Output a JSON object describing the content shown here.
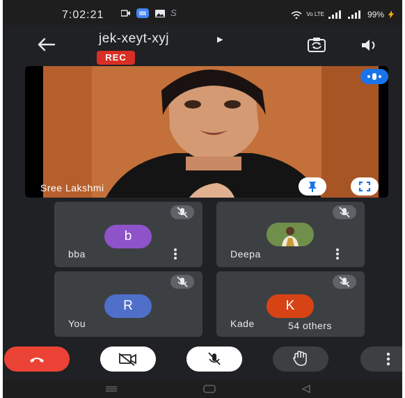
{
  "status_bar": {
    "time": "7:02:21",
    "signal_text": "Vo LTE",
    "battery": "99%"
  },
  "meeting": {
    "code": "jek-xeyt-xyj",
    "rec_label": "REC"
  },
  "main_participant": {
    "name": "Sree Lakshmi"
  },
  "participants": [
    {
      "name": "bba",
      "initial": "b",
      "avatar_color": "#8e53c8"
    },
    {
      "name": "Deepa",
      "initial": "",
      "avatar_color": "#8a9a6a"
    },
    {
      "name": "You",
      "initial": "R",
      "avatar_color": "#4f6fc9"
    },
    {
      "name": "Kade",
      "initial": "K",
      "avatar_color": "#d84315"
    }
  ],
  "others_label": "54 others",
  "colors": {
    "end_call": "#ea4335",
    "rec": "#d93025",
    "accent": "#1a73e8"
  }
}
